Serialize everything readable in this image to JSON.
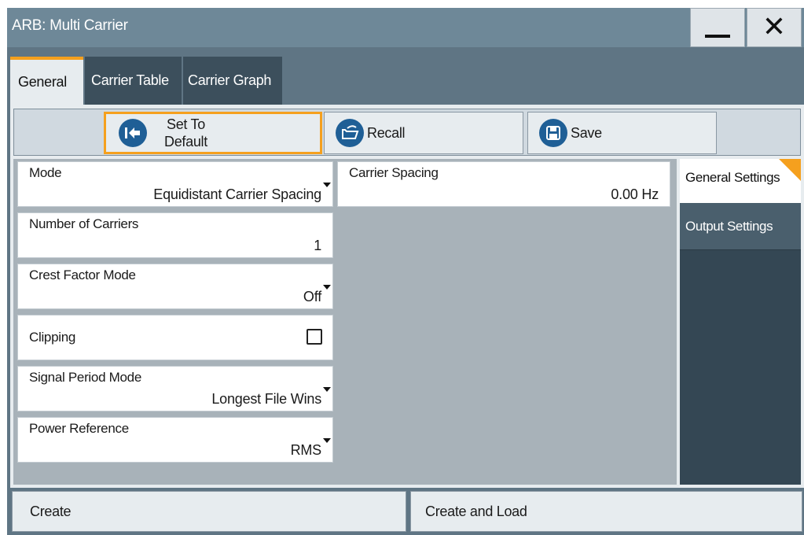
{
  "window": {
    "title": "ARB: Multi Carrier",
    "minimize_icon": "minimize-icon",
    "close_icon": "close-icon"
  },
  "tabs": [
    {
      "label": "General",
      "active": true
    },
    {
      "label": "Carrier Table",
      "active": false
    },
    {
      "label": "Carrier Graph",
      "active": false
    }
  ],
  "toolbar": {
    "set_default": {
      "line1": "Set To",
      "line2": "Default",
      "icon": "set-default-icon"
    },
    "recall": {
      "label": "Recall",
      "icon": "folder-open-icon"
    },
    "save": {
      "label": "Save",
      "icon": "floppy-disk-icon"
    }
  },
  "fields": {
    "mode": {
      "label": "Mode",
      "value": "Equidistant Carrier Spacing"
    },
    "carrier_spacing": {
      "label": "Carrier Spacing",
      "value": "0.00 Hz"
    },
    "number_of_carriers": {
      "label": "Number of Carriers",
      "value": "1"
    },
    "crest_factor_mode": {
      "label": "Crest Factor Mode",
      "value": "Off"
    },
    "clipping": {
      "label": "Clipping",
      "checked": false
    },
    "signal_period_mode": {
      "label": "Signal Period Mode",
      "value": "Longest File Wins"
    },
    "power_reference": {
      "label": "Power Reference",
      "value": "RMS"
    }
  },
  "side_nav": [
    {
      "label": "General Settings",
      "active": true
    },
    {
      "label": "Output Settings",
      "active": false
    }
  ],
  "bottom": {
    "create": "Create",
    "create_and_load": "Create and Load"
  },
  "colors": {
    "accent": "#f5a01e",
    "icon_blue": "#1f5f96",
    "title_bar": "#6e8898"
  }
}
